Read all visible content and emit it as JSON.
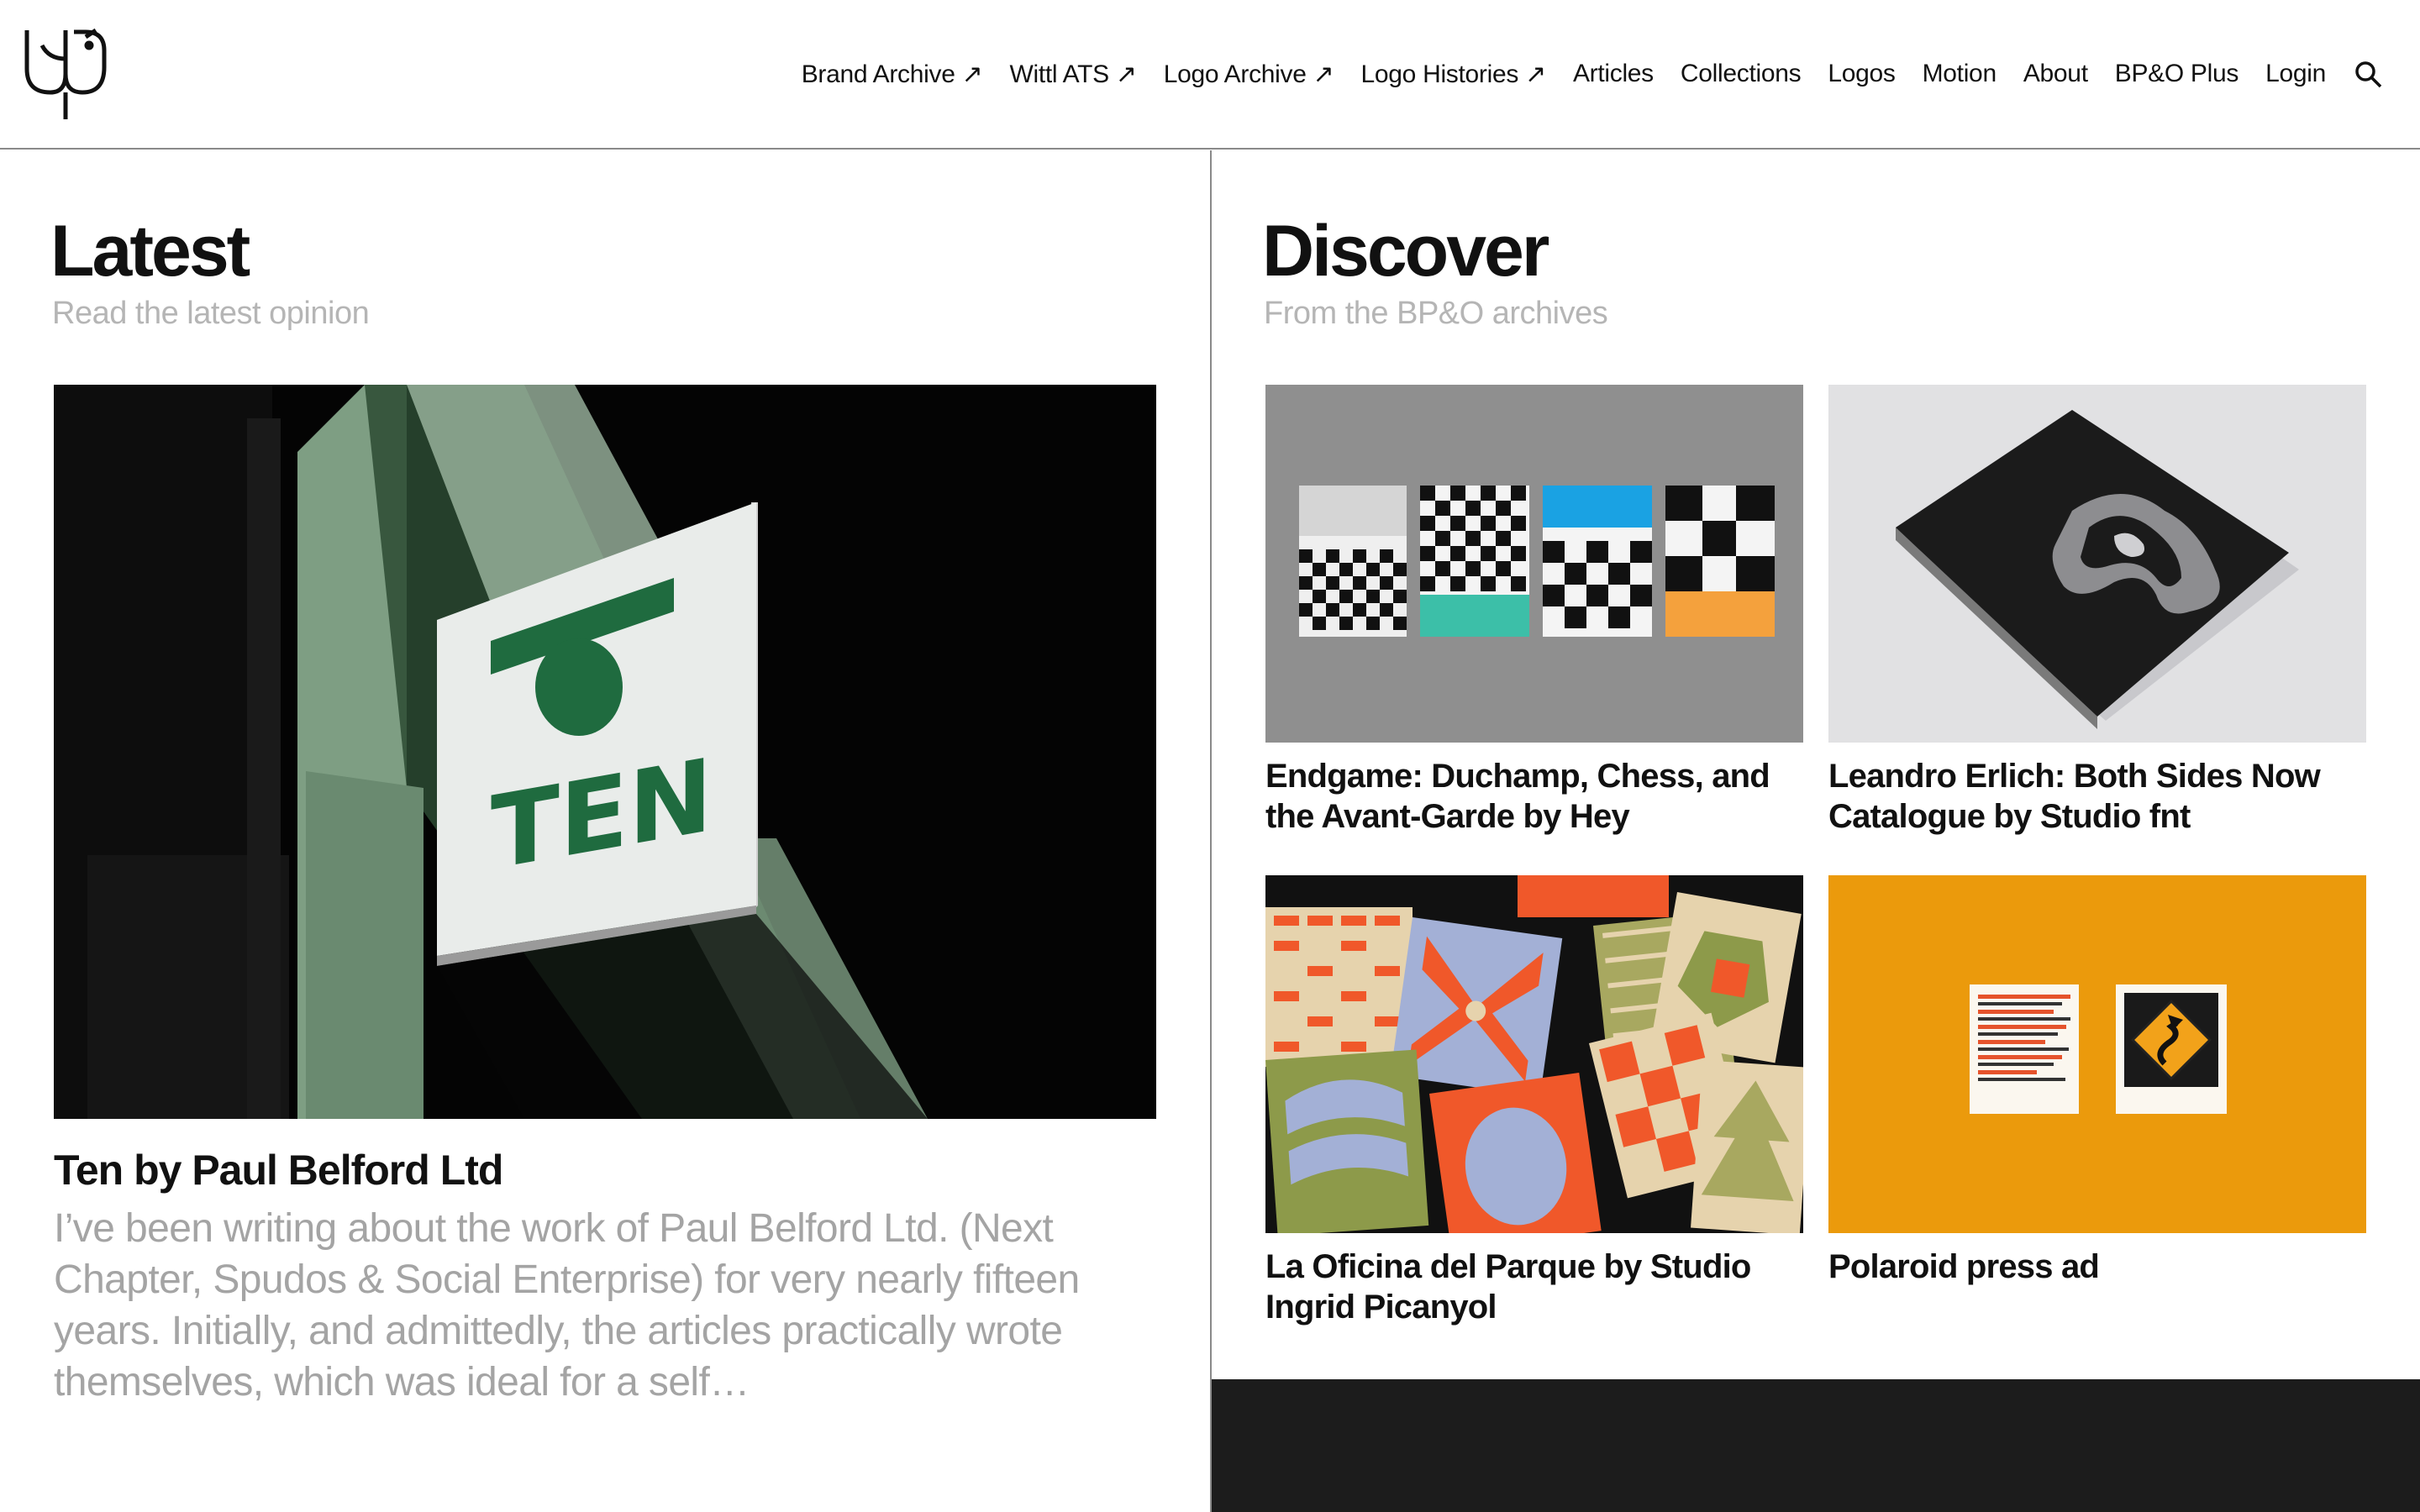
{
  "nav": {
    "items": [
      {
        "label": "Brand Archive ↗"
      },
      {
        "label": "Wittl ATS ↗"
      },
      {
        "label": "Logo Archive ↗"
      },
      {
        "label": "Logo Histories ↗"
      },
      {
        "label": "Articles"
      },
      {
        "label": "Collections"
      },
      {
        "label": "Logos"
      },
      {
        "label": "Motion"
      },
      {
        "label": "About"
      },
      {
        "label": "BP&O Plus"
      },
      {
        "label": "Login"
      }
    ],
    "search_icon": "search-icon"
  },
  "latest": {
    "title": "Latest",
    "subtitle": "Read the latest opinion",
    "article": {
      "title": "Ten by Paul Belford Ltd",
      "excerpt": "I’ve been writing about the work of Paul Belford Ltd. (Next Chapter, Spudos & Social Enterprise) for very nearly fifteen years. Initially, and admittedly, the articles practically wrote themselves, which was ideal for a self…",
      "sign_text": "TEN"
    }
  },
  "discover": {
    "title": "Discover",
    "subtitle": "From the BP&O archives",
    "cards": [
      {
        "title": "Endgame: Duchamp, Chess, and the Avant-Garde by Hey"
      },
      {
        "title": "Leandro Erlich: Both Sides Now Catalogue by Studio fnt"
      },
      {
        "title": "La Oficina del Parque by Studio Ingrid Picanyol"
      },
      {
        "title": "Polaroid press ad"
      }
    ]
  },
  "colors": {
    "accent_green": "#1f6b3f",
    "polaroid_orange": "#eb9a0c",
    "divider": "#8a8a8a",
    "muted_text": "#a4a4a4"
  }
}
